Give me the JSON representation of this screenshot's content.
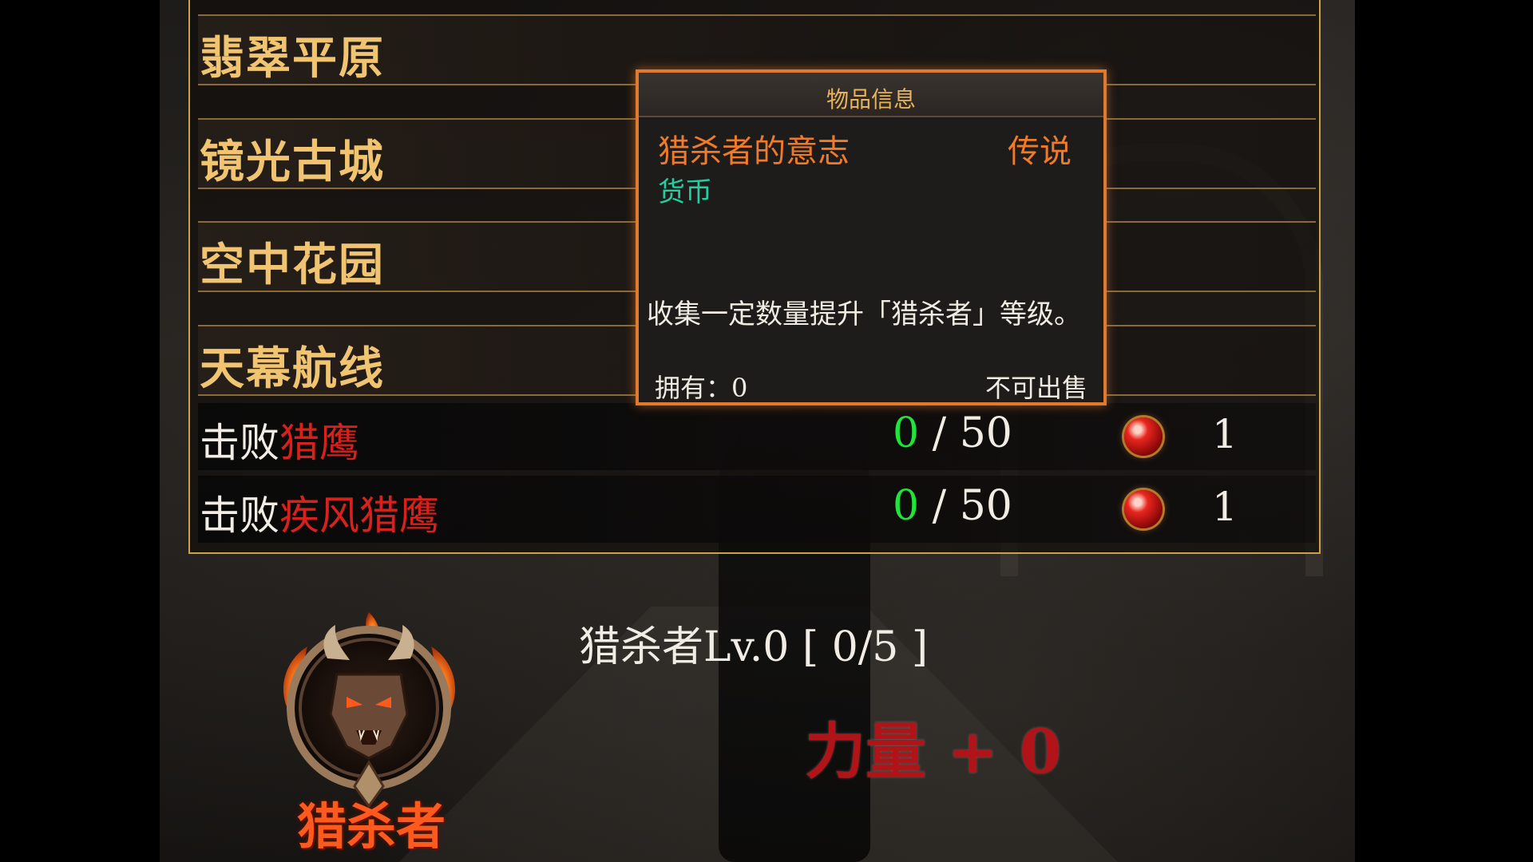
{
  "areas": [
    {
      "label": "翡翠平原"
    },
    {
      "label": "镜光古城"
    },
    {
      "label": "空中花园"
    },
    {
      "label": "天幕航线"
    }
  ],
  "tasks": [
    {
      "prefix": "击败",
      "target": "猎鹰",
      "current": "0",
      "separator": "/",
      "total": "50",
      "reward_icon": "red-orb-icon",
      "reward_count": "1"
    },
    {
      "prefix": "击败",
      "target": "疾风猎鹰",
      "current": "0",
      "separator": "/",
      "total": "50",
      "reward_icon": "red-orb-icon",
      "reward_count": "1"
    }
  ],
  "tooltip": {
    "header": "物品信息",
    "item_name": "猎杀者的意志",
    "rarity": "传说",
    "item_type": "货币",
    "description": "收集一定数量提升「猎杀者」等级。",
    "owned": "拥有：0",
    "sellable": "不可出售"
  },
  "hunter": {
    "class_name": "猎杀者",
    "level_text": "猎杀者Lv.0 [ 0/5 ]",
    "stat_text": "力量 + 0",
    "emblem_icon": "demon-emblem-icon"
  },
  "colors": {
    "gold": "#f0c470",
    "target_red": "#d8201c",
    "progress_green": "#22e33a",
    "legendary_orange": "#ee7a2a",
    "currency_teal": "#1fd0a0",
    "class_orange": "#ff5a1e",
    "stat_red": "#b01418"
  }
}
